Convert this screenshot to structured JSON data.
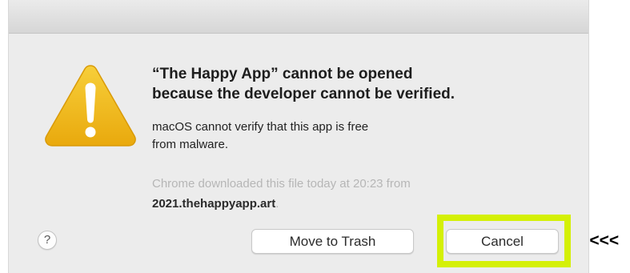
{
  "dialog": {
    "headline_line1": "“The Happy App” cannot be opened",
    "headline_line2": "because the developer cannot be verified.",
    "message_line1": "macOS cannot verify that this app is free",
    "message_line2": "from malware.",
    "source_note": "Chrome downloaded this file today at 20:23 from",
    "source_host": "2021.thehappyapp.art",
    "source_period": "."
  },
  "buttons": {
    "help_label": "?",
    "move_to_trash_label": "Move to Trash",
    "cancel_label": "Cancel"
  },
  "annotation": {
    "marker_text": "<<<",
    "highlight_color": "#d4f006"
  },
  "icons": {
    "warning": "warning-icon"
  },
  "colors": {
    "dialog_bg": "#ececec",
    "warning_yellow": "#f0b514"
  }
}
